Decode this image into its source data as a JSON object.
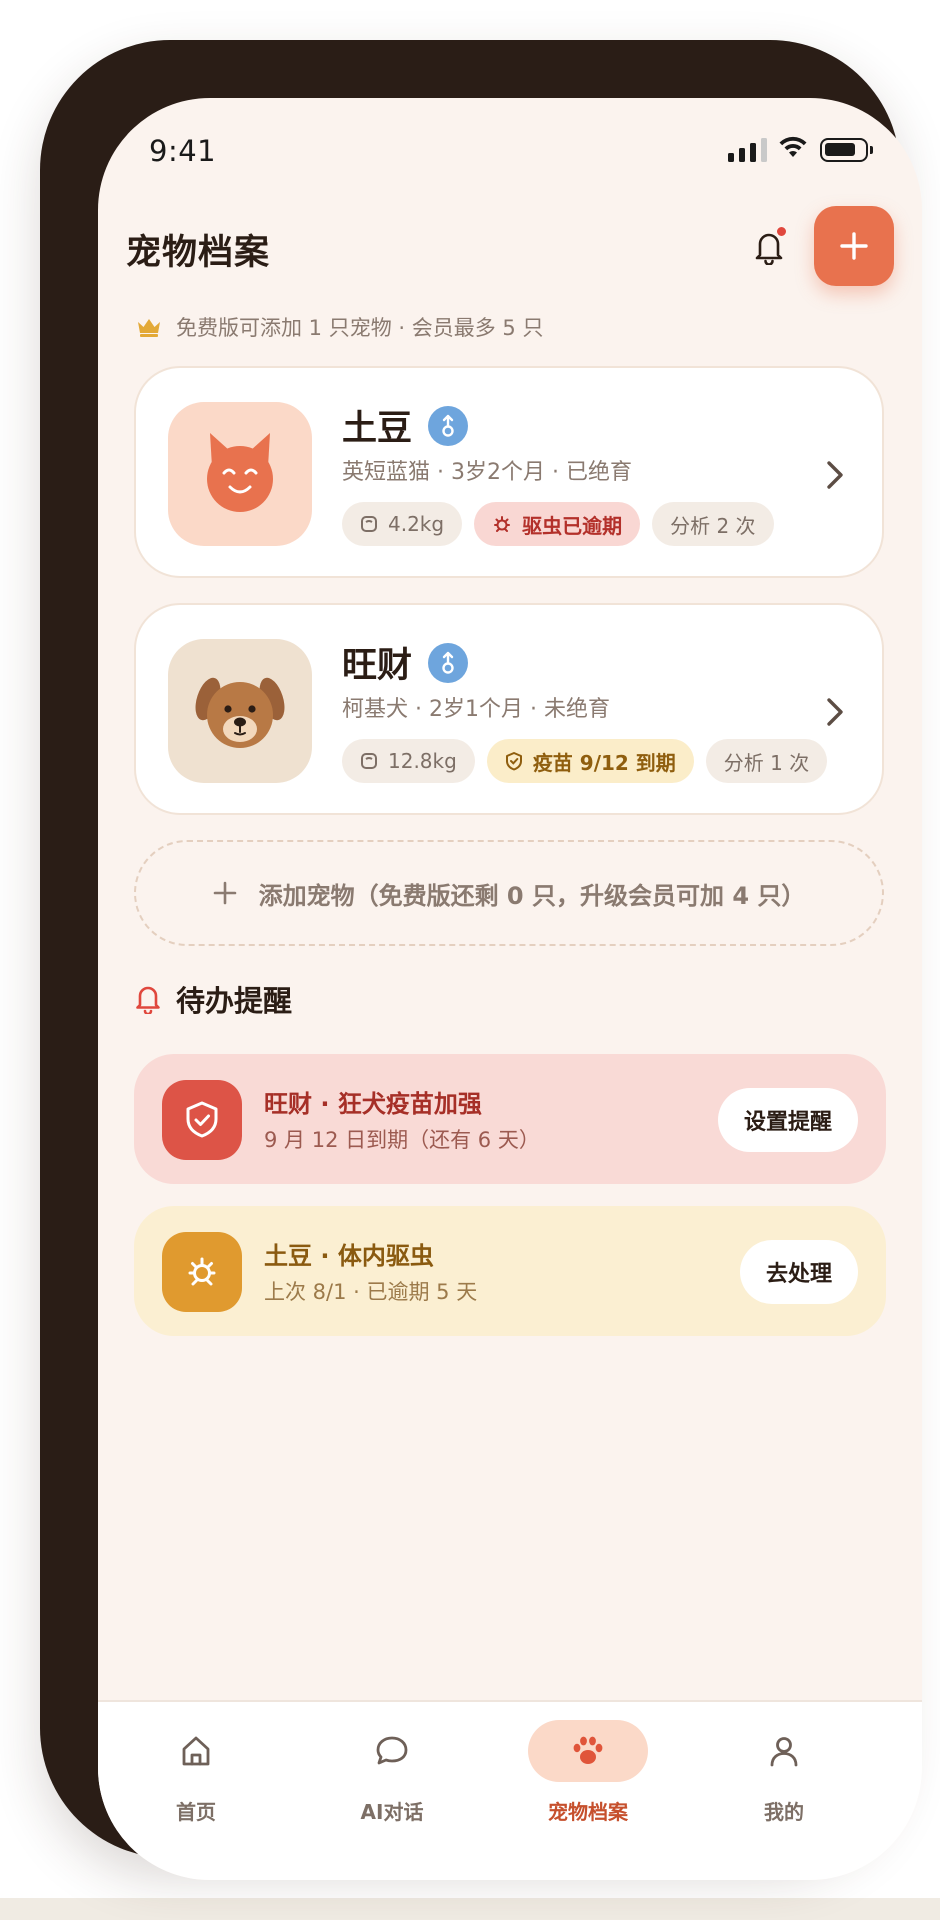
{
  "status_bar": {
    "time": "9:41"
  },
  "header": {
    "title": "宠物档案"
  },
  "membership": {
    "note": "免费版可添加 1 只宠物 · 会员最多 5 只"
  },
  "pets": [
    {
      "name": "土豆",
      "info": "英短蓝猫 · 3岁2个月 · 已绝育",
      "tags": [
        {
          "label": "4.2kg",
          "icon": "scale-icon"
        },
        {
          "label": "驱虫已逾期",
          "icon": "bug-icon"
        },
        {
          "label": "分析 2 次"
        }
      ],
      "avatar_color": "#fbd9c8"
    },
    {
      "name": "旺财",
      "info": "柯基犬 · 2岁1个月 · 未绝育",
      "tags": [
        {
          "label": "12.8kg",
          "icon": "scale-icon"
        },
        {
          "label": "疫苗 9/12 到期",
          "icon": "shield-icon"
        },
        {
          "label": "分析 1 次"
        }
      ],
      "avatar_color": "#efe1d0"
    }
  ],
  "add_pet": {
    "label": "添加宠物（免费版还剩 0 只，升级会员可加 4 只）"
  },
  "reminders": {
    "title": "待办提醒",
    "items": [
      {
        "title": "旺财 · 狂犬疫苗加强",
        "subtitle": "9 月 12 日到期（还有 6 天）",
        "action": "设置提醒",
        "color": "#dd5447"
      },
      {
        "title": "土豆 · 体内驱虫",
        "subtitle": "上次 8/1 · 已逾期 5 天",
        "action": "去处理",
        "color": "#e09a2f"
      }
    ]
  },
  "tabbar": {
    "tabs": [
      {
        "label": "首页",
        "icon": "home-icon"
      },
      {
        "label": "AI对话",
        "icon": "chat-icon"
      },
      {
        "label": "宠物档案",
        "icon": "paw-icon",
        "active": true
      },
      {
        "label": "我的",
        "icon": "profile-icon"
      }
    ]
  },
  "colors": {
    "accent": "#e8724e",
    "background": "#fbf3ee",
    "danger": "#b3302a",
    "warning": "#8f5e0e"
  }
}
